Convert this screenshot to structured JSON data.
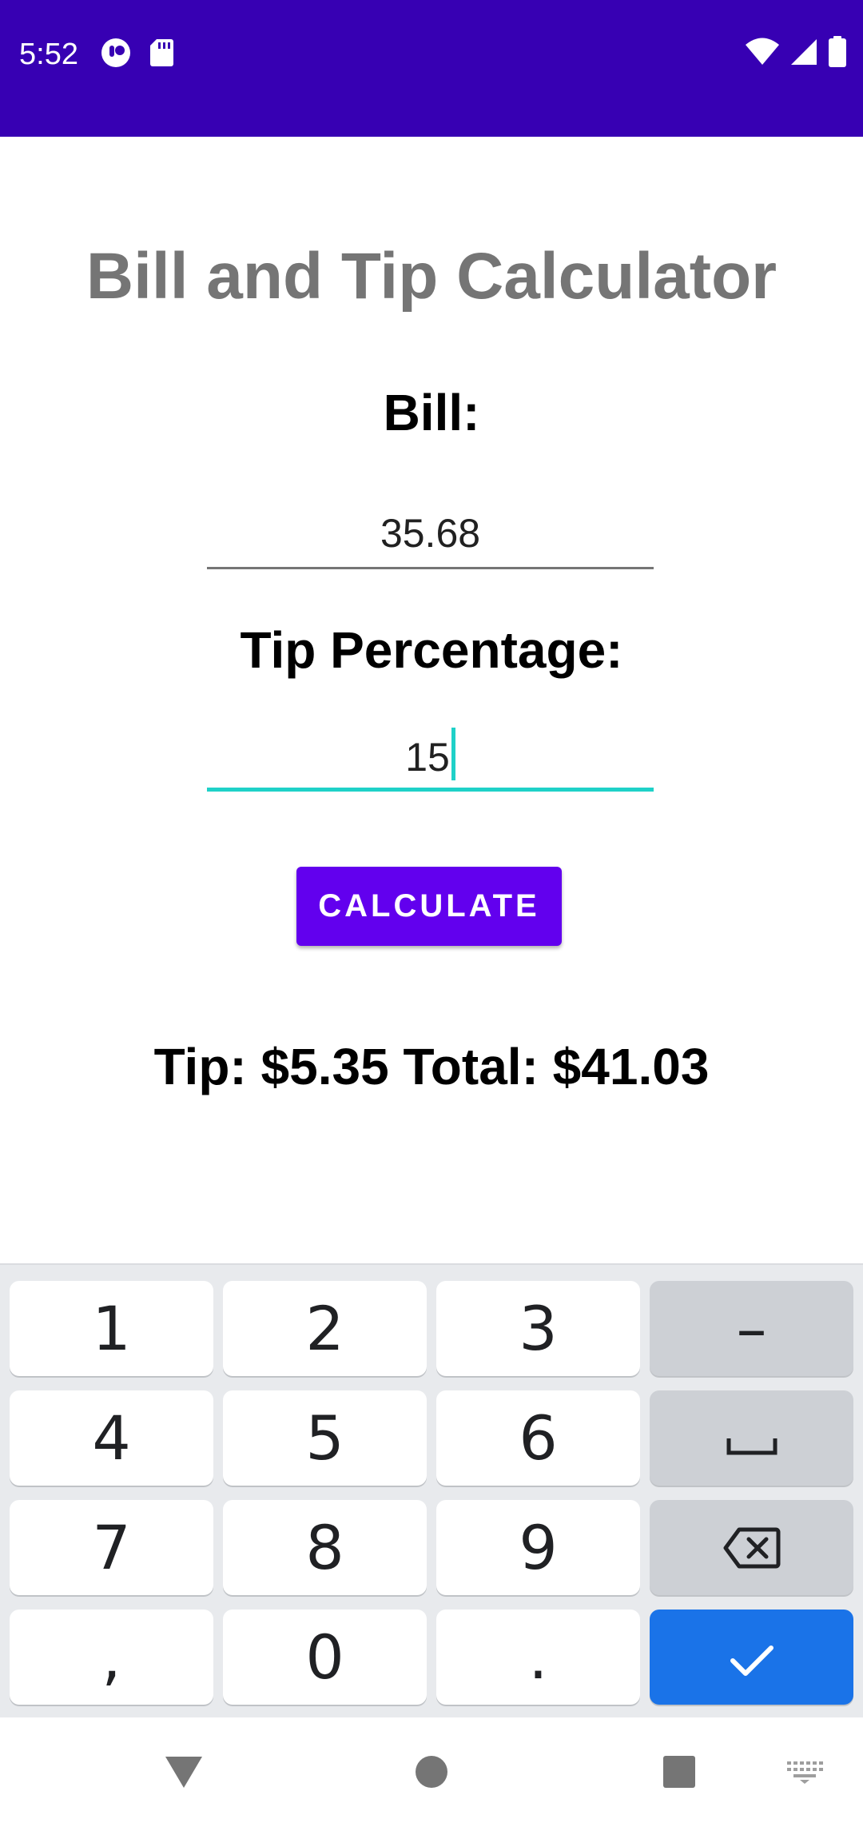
{
  "status_bar": {
    "time": "5:52",
    "background_color": "#3700b3",
    "left_icons": [
      "notification-app-icon",
      "sd-card-icon"
    ],
    "right_icons": [
      "wifi-icon",
      "cell-signal-icon",
      "battery-icon"
    ]
  },
  "app": {
    "title": "Bill and Tip Calculator",
    "title_color": "#757575"
  },
  "form": {
    "bill_label": "Bill:",
    "bill_value": "35.68",
    "tip_label": "Tip Percentage:",
    "tip_value": "15",
    "focused_field": "tip",
    "accent_color": "#1fd1c8"
  },
  "calculate_button": {
    "label": "CALCULATE",
    "color": "#6200ee"
  },
  "result": {
    "text": "Tip: $5.35 Total: $41.03"
  },
  "keyboard": {
    "rows": [
      [
        "1",
        "2",
        "3",
        "–"
      ],
      [
        "4",
        "5",
        "6",
        "space"
      ],
      [
        "7",
        "8",
        "9",
        "backspace"
      ],
      [
        ",",
        "0",
        ".",
        "done"
      ]
    ],
    "digit_keys": {
      "k1": "1",
      "k2": "2",
      "k3": "3",
      "k4": "4",
      "k5": "5",
      "k6": "6",
      "k7": "7",
      "k8": "8",
      "k9": "9",
      "comma": ",",
      "k0": "0",
      "period": "."
    },
    "minus_key": "–",
    "space_key_icon": "space-bar-icon",
    "backspace_key_icon": "backspace-icon",
    "done_key_icon": "checkmark-icon",
    "action_color": "#1a73e8"
  },
  "nav_bar": {
    "buttons": [
      "back-icon",
      "home-icon",
      "recents-icon",
      "keyboard-switch-icon"
    ]
  }
}
